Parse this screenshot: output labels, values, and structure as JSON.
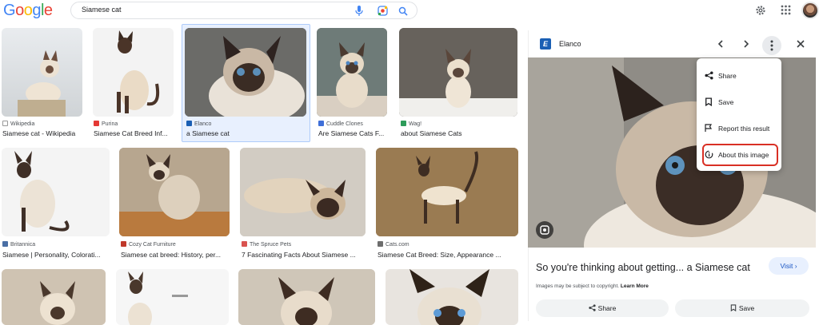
{
  "header": {
    "logo": [
      "G",
      "o",
      "o",
      "g",
      "l",
      "e"
    ],
    "logo_colors": [
      "#4285F4",
      "#EA4335",
      "#FBBC05",
      "#4285F4",
      "#34A853",
      "#EA4335"
    ],
    "query": "Siamese cat"
  },
  "results": [
    {
      "source": "Wikipedia",
      "title": "Siamese cat - Wikipedia",
      "fav_color": "#555555"
    },
    {
      "source": "Purina",
      "title": "Siamese Cat Breed Inf...",
      "fav_color": "#e53935"
    },
    {
      "source": "Elanco",
      "title": "a Siamese cat",
      "fav_color": "#1a5fb4"
    },
    {
      "source": "Cuddle Clones",
      "title": "Are Siamese Cats F...",
      "fav_color": "#3f6fd8"
    },
    {
      "source": "Wag!",
      "title": "about Siamese Cats",
      "fav_color": "#2e9c5a"
    },
    {
      "source": "Britannica",
      "title": "Siamese | Personality, Colorati...",
      "fav_color": "#4a6fa5"
    },
    {
      "source": "Cozy Cat Furniture",
      "title": "Siamese cat breed: History, per...",
      "fav_color": "#c0392b"
    },
    {
      "source": "The Spruce Pets",
      "title": "7 Fascinating Facts About Siamese ...",
      "fav_color": "#d9534f"
    },
    {
      "source": "Cats.com",
      "title": "Siamese Cat Breed: Size, Appearance ...",
      "fav_color": "#6d6d6d"
    }
  ],
  "panel": {
    "brand_letter": "E",
    "source": "Elanco",
    "title": "So you're thinking about getting... a Siamese cat",
    "visit_label": "Visit",
    "copyright": "Images may be subject to copyright.",
    "learn_more": "Learn More",
    "share_label": "Share",
    "save_label": "Save"
  },
  "menu": {
    "items": [
      "Share",
      "Save",
      "Report this result",
      "About this image"
    ]
  }
}
